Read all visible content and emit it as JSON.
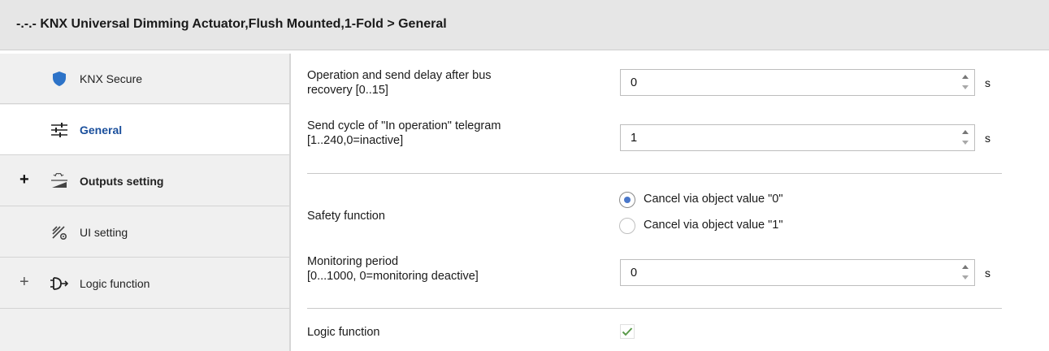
{
  "window": {
    "title": "-.-.- KNX Universal Dimming Actuator,Flush Mounted,1-Fold > General"
  },
  "sidebar": {
    "items": [
      {
        "label": "KNX Secure",
        "icon": "shield-icon",
        "expand": ""
      },
      {
        "label": "General",
        "icon": "sliders-icon",
        "expand": "",
        "active": true
      },
      {
        "label": "Outputs setting",
        "icon": "dimmer-lamp-icon",
        "expand": "+"
      },
      {
        "label": "UI setting",
        "icon": "ui-tools-icon",
        "expand": ""
      },
      {
        "label": "Logic function",
        "icon": "logic-gate-icon",
        "expand": "+"
      }
    ]
  },
  "main": {
    "params": {
      "bus_delay": {
        "label_line1": "Operation and send delay after bus",
        "label_line2": "recovery [0..15]",
        "value": "0",
        "unit": "s"
      },
      "send_cycle": {
        "label_line1": "Send cycle of  \"In operation\" telegram",
        "label_line2": "[1..240,0=inactive]",
        "value": "1",
        "unit": "s"
      },
      "safety": {
        "label": "Safety function",
        "options": [
          {
            "label": "Cancel via object value \"0\"",
            "selected": true
          },
          {
            "label": "Cancel via object value \"1\"",
            "selected": false
          }
        ]
      },
      "monitoring": {
        "label_line1": "Monitoring period",
        "label_line2": "[0...1000, 0=monitoring deactive]",
        "value": "0",
        "unit": "s"
      },
      "logic": {
        "label": "Logic function",
        "checked": true
      }
    }
  },
  "colors": {
    "accent": "#1a4f9c",
    "radio_dot": "#4a77c9",
    "check": "#5a9a4a",
    "shield": "#2d73c8"
  }
}
